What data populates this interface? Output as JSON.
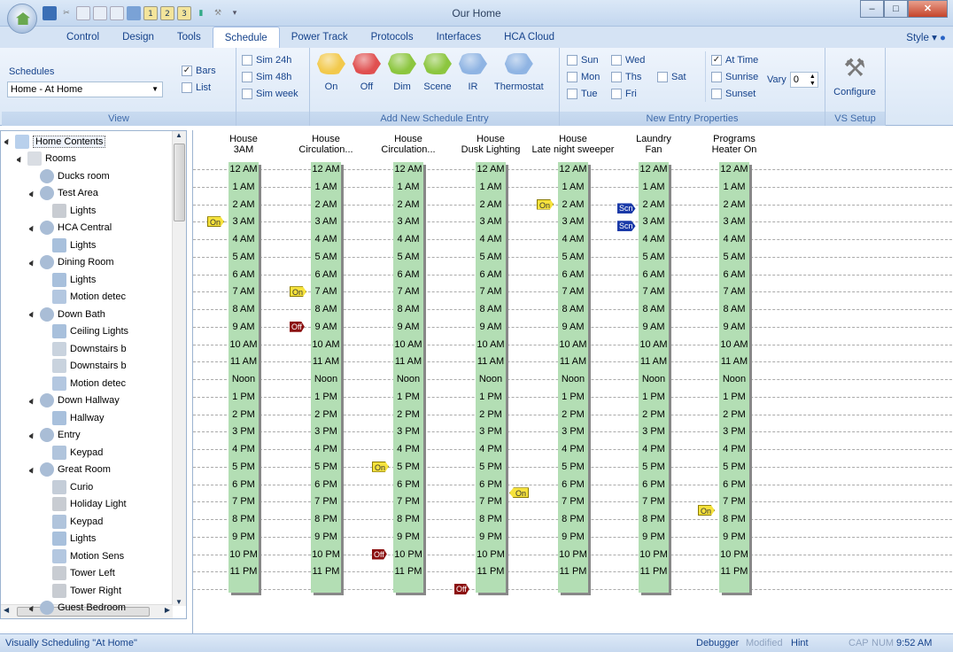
{
  "window": {
    "title": "Our Home"
  },
  "ribbon_tabs": [
    "Control",
    "Design",
    "Tools",
    "Schedule",
    "Power Track",
    "Protocols",
    "Interfaces",
    "HCA Cloud"
  ],
  "style_label": "Style",
  "view_group": {
    "label": "View",
    "schedules_label": "Schedules",
    "schedule_value": "Home - At Home",
    "bars_label": "Bars",
    "bars_checked": true,
    "list_label": "List",
    "list_checked": false,
    "sim24": "Sim 24h",
    "sim48": "Sim 48h",
    "simweek": "Sim week"
  },
  "add_group": {
    "label": "Add New Schedule Entry",
    "buttons": [
      {
        "label": "On",
        "color": "#f2c94c"
      },
      {
        "label": "Off",
        "color": "#e05050"
      },
      {
        "label": "Dim",
        "color": "#8cc63f"
      },
      {
        "label": "Scene",
        "color": "#8cc63f"
      },
      {
        "label": "IR",
        "color": "#8fb4e3"
      },
      {
        "label": "Thermostat",
        "color": "#8fb4e3"
      }
    ]
  },
  "props_group": {
    "label": "New Entry Properties",
    "days": [
      "Sun",
      "Wed",
      "Mon",
      "Ths",
      "Sat",
      "Tue",
      "Fri"
    ],
    "at_time": "At Time",
    "sunrise": "Sunrise",
    "sunset": "Sunset",
    "vary_label": "Vary",
    "vary_value": "0"
  },
  "vs_group": {
    "label": "VS Setup",
    "configure": "Configure"
  },
  "tree": [
    {
      "label": "Home Contents",
      "indent": 0,
      "icon": "house-icon",
      "expander": "▲"
    },
    {
      "label": "Rooms",
      "indent": 1,
      "icon": "folder-icon",
      "expander": "▲"
    },
    {
      "label": "Ducks room",
      "indent": 2,
      "icon": "room-icon",
      "expander": ""
    },
    {
      "label": "Test Area",
      "indent": 2,
      "icon": "room-icon",
      "expander": "▲"
    },
    {
      "label": "Lights",
      "indent": 3,
      "icon": "lamp-icon",
      "expander": ""
    },
    {
      "label": "HCA Central",
      "indent": 2,
      "icon": "room-icon",
      "expander": "▲"
    },
    {
      "label": "Lights",
      "indent": 3,
      "icon": "switch-icon",
      "expander": ""
    },
    {
      "label": "Dining Room",
      "indent": 2,
      "icon": "room-icon",
      "expander": "▲"
    },
    {
      "label": "Lights",
      "indent": 3,
      "icon": "switch-icon",
      "expander": ""
    },
    {
      "label": "Motion detec",
      "indent": 3,
      "icon": "motion-icon",
      "expander": ""
    },
    {
      "label": "Down Bath",
      "indent": 2,
      "icon": "room-icon",
      "expander": "▲"
    },
    {
      "label": "Ceiling Lights",
      "indent": 3,
      "icon": "switch-icon",
      "expander": ""
    },
    {
      "label": "Downstairs b",
      "indent": 3,
      "icon": "gear-icon",
      "expander": ""
    },
    {
      "label": "Downstairs b",
      "indent": 3,
      "icon": "gear-icon",
      "expander": ""
    },
    {
      "label": "Motion detec",
      "indent": 3,
      "icon": "motion-icon",
      "expander": ""
    },
    {
      "label": "Down Hallway",
      "indent": 2,
      "icon": "room-icon",
      "expander": "▲"
    },
    {
      "label": "Hallway",
      "indent": 3,
      "icon": "switch-icon",
      "expander": ""
    },
    {
      "label": "Entry",
      "indent": 2,
      "icon": "room-icon",
      "expander": "▲"
    },
    {
      "label": "Keypad",
      "indent": 3,
      "icon": "keypad-icon",
      "expander": ""
    },
    {
      "label": "Great Room",
      "indent": 2,
      "icon": "room-icon",
      "expander": "▲"
    },
    {
      "label": "Curio",
      "indent": 3,
      "icon": "outlet-icon",
      "expander": ""
    },
    {
      "label": "Holiday Light",
      "indent": 3,
      "icon": "lamp-icon",
      "expander": ""
    },
    {
      "label": "Keypad",
      "indent": 3,
      "icon": "keypad-icon",
      "expander": ""
    },
    {
      "label": "Lights",
      "indent": 3,
      "icon": "switch-icon",
      "expander": ""
    },
    {
      "label": "Motion Sens",
      "indent": 3,
      "icon": "motion-icon",
      "expander": ""
    },
    {
      "label": "Tower Left",
      "indent": 3,
      "icon": "lamp-icon",
      "expander": ""
    },
    {
      "label": "Tower Right",
      "indent": 3,
      "icon": "floorlamp-icon",
      "expander": ""
    },
    {
      "label": "Guest Bedroom",
      "indent": 2,
      "icon": "room-icon",
      "expander": "▲"
    }
  ],
  "hours": [
    "12 AM",
    "1 AM",
    "2 AM",
    "3 AM",
    "4 AM",
    "5 AM",
    "6 AM",
    "7 AM",
    "8 AM",
    "9 AM",
    "10 AM",
    "11 AM",
    "Noon",
    "1 PM",
    "2 PM",
    "3 PM",
    "4 PM",
    "5 PM",
    "6 PM",
    "7 PM",
    "8 PM",
    "9 PM",
    "10 PM",
    "11 PM"
  ],
  "columns": [
    {
      "line1": "House",
      "line2": "3AM"
    },
    {
      "line1": "House",
      "line2": "Circulation..."
    },
    {
      "line1": "House",
      "line2": "Circulation..."
    },
    {
      "line1": "House",
      "line2": "Dusk Lighting"
    },
    {
      "line1": "House",
      "line2": "Late night sweeper"
    },
    {
      "line1": "Laundry",
      "line2": "Fan"
    },
    {
      "line1": "Programs",
      "line2": "Heater On"
    }
  ],
  "markers": [
    {
      "col": 0,
      "hour": 3.0,
      "type": "on",
      "label": "On",
      "side": "left"
    },
    {
      "col": 1,
      "hour": 7.0,
      "type": "on",
      "label": "On",
      "side": "left"
    },
    {
      "col": 1,
      "hour": 9.0,
      "type": "off",
      "label": "Off",
      "side": "left"
    },
    {
      "col": 2,
      "hour": 17.0,
      "type": "on",
      "label": "On",
      "side": "left"
    },
    {
      "col": 2,
      "hour": 22.0,
      "type": "off",
      "label": "Off",
      "side": "left"
    },
    {
      "col": 3,
      "hour": 18.5,
      "type": "on",
      "label": "On",
      "side": "right"
    },
    {
      "col": 3,
      "hour": 24.0,
      "type": "off",
      "label": "Off",
      "side": "left"
    },
    {
      "col": 4,
      "hour": 2.0,
      "type": "on",
      "label": "On",
      "side": "left"
    },
    {
      "col": 5,
      "hour": 2.25,
      "type": "scn",
      "label": "Scn",
      "side": "left"
    },
    {
      "col": 5,
      "hour": 3.25,
      "type": "scn",
      "label": "Scn",
      "side": "left"
    },
    {
      "col": 6,
      "hour": 19.5,
      "type": "on",
      "label": "On",
      "side": "left"
    }
  ],
  "status": {
    "text": "Visually Scheduling \"At Home\"",
    "debugger": "Debugger",
    "modified": "Modified",
    "hint": "Hint",
    "cap": "CAP",
    "num": "NUM",
    "time": "9:52 AM"
  }
}
